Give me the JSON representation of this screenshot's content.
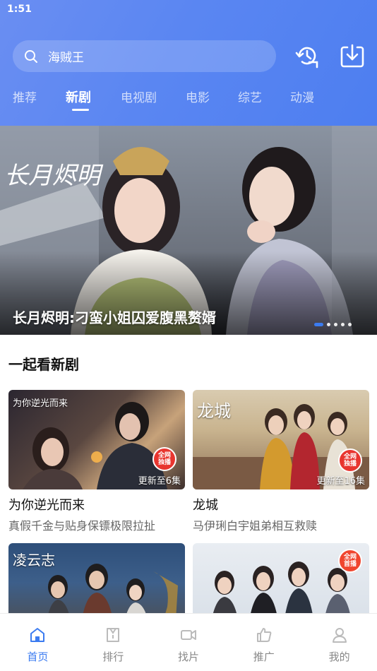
{
  "status_bar": {
    "time": "1:51"
  },
  "header": {
    "search_query": "海贼王",
    "icons": [
      "search-icon",
      "history-icon",
      "download-icon"
    ]
  },
  "tabs": [
    {
      "label": "推荐",
      "active": false
    },
    {
      "label": "新剧",
      "active": true
    },
    {
      "label": "电视剧",
      "active": false
    },
    {
      "label": "电影",
      "active": false
    },
    {
      "label": "综艺",
      "active": false
    },
    {
      "label": "动漫",
      "active": false
    }
  ],
  "banner": {
    "title": "长月烬明:刁蛮小姐囚爱腹黑赘婿",
    "poster_text": "长月烬明",
    "dots": 5,
    "active_dot": 0
  },
  "section": {
    "title": "一起看新剧"
  },
  "cards": [
    {
      "name": "为你逆光而来",
      "desc": "真假千金与贴身保镖极限拉扯",
      "update": "更新至6集",
      "poster_text": "为你逆光而来",
      "badge": "全网独播"
    },
    {
      "name": "龙城",
      "desc": "马伊琍白宇姐弟相互救赎",
      "update": "更新至16集",
      "poster_text": "龙城",
      "badge": "全网独播"
    },
    {
      "name": "",
      "desc": "",
      "update": "",
      "poster_text": "凌云志",
      "badge": ""
    },
    {
      "name": "",
      "desc": "",
      "update": "",
      "poster_text": "",
      "badge": "全网首播"
    }
  ],
  "bottom_nav": [
    {
      "label": "首页",
      "icon": "home-icon",
      "active": true
    },
    {
      "label": "排行",
      "icon": "ranking-icon",
      "active": false
    },
    {
      "label": "找片",
      "icon": "video-camera-icon",
      "active": false
    },
    {
      "label": "推广",
      "icon": "thumbs-up-icon",
      "active": false
    },
    {
      "label": "我的",
      "icon": "user-icon",
      "active": false
    }
  ],
  "colors": {
    "accent": "#3b7bf0",
    "header_gradient_start": "#6a8ef2",
    "header_gradient_end": "#4d7ef0"
  }
}
